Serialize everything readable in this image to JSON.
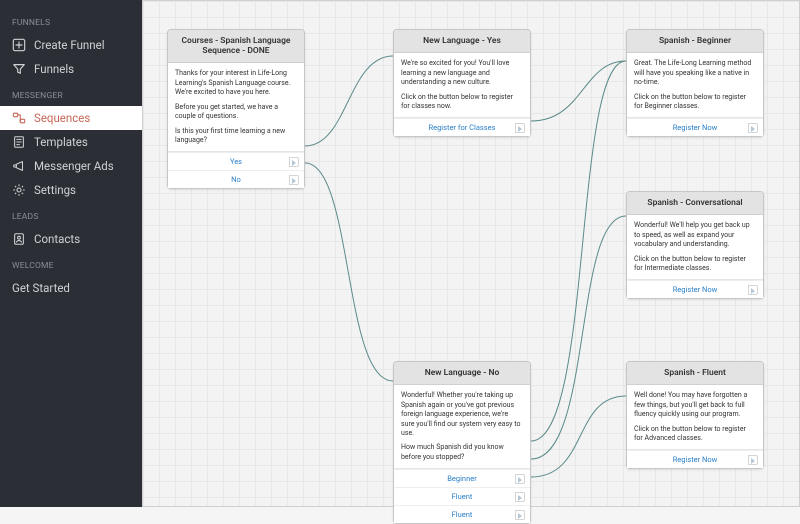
{
  "sidebar": {
    "sections": {
      "funnels": {
        "label": "FUNNELS",
        "items": [
          {
            "label": "Create Funnel"
          },
          {
            "label": "Funnels"
          }
        ]
      },
      "messenger": {
        "label": "MESSENGER",
        "items": [
          {
            "label": "Sequences"
          },
          {
            "label": "Templates"
          },
          {
            "label": "Messenger Ads"
          },
          {
            "label": "Settings"
          }
        ]
      },
      "leads": {
        "label": "LEADS",
        "items": [
          {
            "label": "Contacts"
          }
        ]
      },
      "welcome": {
        "label": "WELCOME",
        "items": [
          {
            "label": "Get Started"
          }
        ]
      }
    }
  },
  "nodes": {
    "start": {
      "title": "Courses - Spanish Language Sequence - DONE",
      "body": [
        "Thanks for your interest in Life-Long Learning's Spanish Language course. We're excited to have you here.",
        "Before you get started, we have a couple of questions.",
        "Is this your first time learning a new language?"
      ],
      "buttons": [
        "Yes",
        "No"
      ]
    },
    "newYes": {
      "title": "New Language - Yes",
      "body": [
        "We're so excited for you! You'll love learning a new language and understanding a new culture.",
        "Click on the button below to register for classes now."
      ],
      "buttons": [
        "Register for Classes"
      ]
    },
    "newNo": {
      "title": "New Language - No",
      "body": [
        "Wonderful! Whether you're taking up Spanish again or you've got previous foreign language experience, we're sure you'll find our system very easy to use.",
        "How much Spanish did you know before you stopped?"
      ],
      "buttons": [
        "Beginner",
        "Fluent",
        "Fluent"
      ]
    },
    "beginner": {
      "title": "Spanish - Beginner",
      "body": [
        "Great. The Life-Long Learning method will have you speaking like a native in no-time.",
        "Click on the button below to register for Beginner classes."
      ],
      "buttons": [
        "Register Now"
      ]
    },
    "conversational": {
      "title": "Spanish - Conversational",
      "body": [
        "Wonderful! We'll help you get back up to speed, as well as expand your vocabulary and understanding.",
        "Click on the button below to register for Intermediate classes."
      ],
      "buttons": [
        "Register Now"
      ]
    },
    "fluent": {
      "title": "Spanish - Fluent",
      "body": [
        "Well done! You may have forgotten a few things, but you'll get back to full fluency quickly using our program.",
        "Click on the button below to register for Advanced classes."
      ],
      "buttons": [
        "Register Now"
      ]
    }
  },
  "colors": {
    "accent": "#c66757",
    "link": "#2a7fc7",
    "edge": "#5b8a8a"
  }
}
